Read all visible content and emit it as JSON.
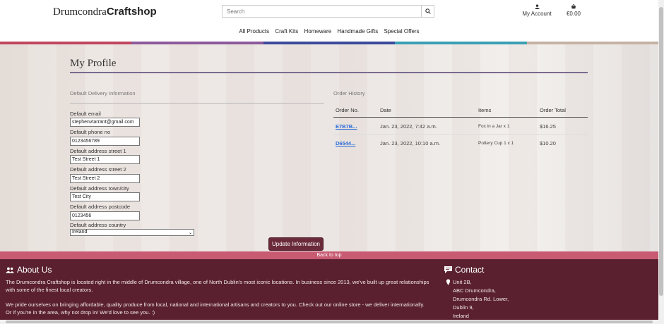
{
  "header": {
    "logo_part1": "Drumcondra",
    "logo_part2": "Craftshop",
    "search_placeholder": "Search",
    "account_label": "My Account",
    "bag_total": "€0.00"
  },
  "nav": {
    "items": [
      "All Products",
      "Craft Kits",
      "Homeware",
      "Handmade Gifts",
      "Special Offers"
    ]
  },
  "stripe_colors": [
    "#c0465e",
    "#8c5a9c",
    "#3b4a9c",
    "#3a9fb5",
    "#c5b2a4"
  ],
  "page": {
    "title": "My Profile",
    "delivery_heading": "Default Delivery Information",
    "order_history_heading": "Order History"
  },
  "form": {
    "email_label": "Default email",
    "email_value": "stephenvtarrant@gmail.com",
    "phone_label": "Default phone no",
    "phone_value": "0123456789",
    "street1_label": "Default address street 1",
    "street1_value": "Test Street 1",
    "street2_label": "Default address street 2",
    "street2_value": "Test Street 2",
    "town_label": "Default address town/city",
    "town_value": "Test City",
    "postcode_label": "Default address postcode",
    "postcode_value": "0123456",
    "country_label": "Default address country",
    "country_value": "Ireland",
    "update_button": "Update Information"
  },
  "orders": {
    "headers": [
      "Order No.",
      "Date",
      "Items",
      "Order Total"
    ],
    "rows": [
      {
        "order_no": "E7B7B...",
        "date": "Jan. 23, 2022, 7:42 a.m.",
        "items": "Fox in a Jar x 1",
        "total": "$16.25"
      },
      {
        "order_no": "D6544...",
        "date": "Jan. 23, 2022, 10:10 a.m.",
        "items": "Pottery Cup 1 x 1",
        "total": "$10.20"
      }
    ]
  },
  "back_to_top": "Back to top",
  "footer": {
    "about_heading": "About Us",
    "about_p1": "The Drumcondra Craftshop is located right in the middle of Drumcondra village, one of North Dublin's most iconic locations. In business since 2013, we've built up great relationships with some of the finest local creators.",
    "about_p2": "We pride ourselves on bringing affordable, quality produce from local, national and international artisans and creators to you. Check out our online store - we deliver internationally. Or if you're in the area, why not drop in! We'd love to see you. :)",
    "contact_heading": "Contact",
    "address": [
      "Unit 2B,",
      "ABC Drumcondra,",
      "Drumcondra Rd. Lower,",
      "Dublin 9,",
      "Ireland"
    ]
  }
}
